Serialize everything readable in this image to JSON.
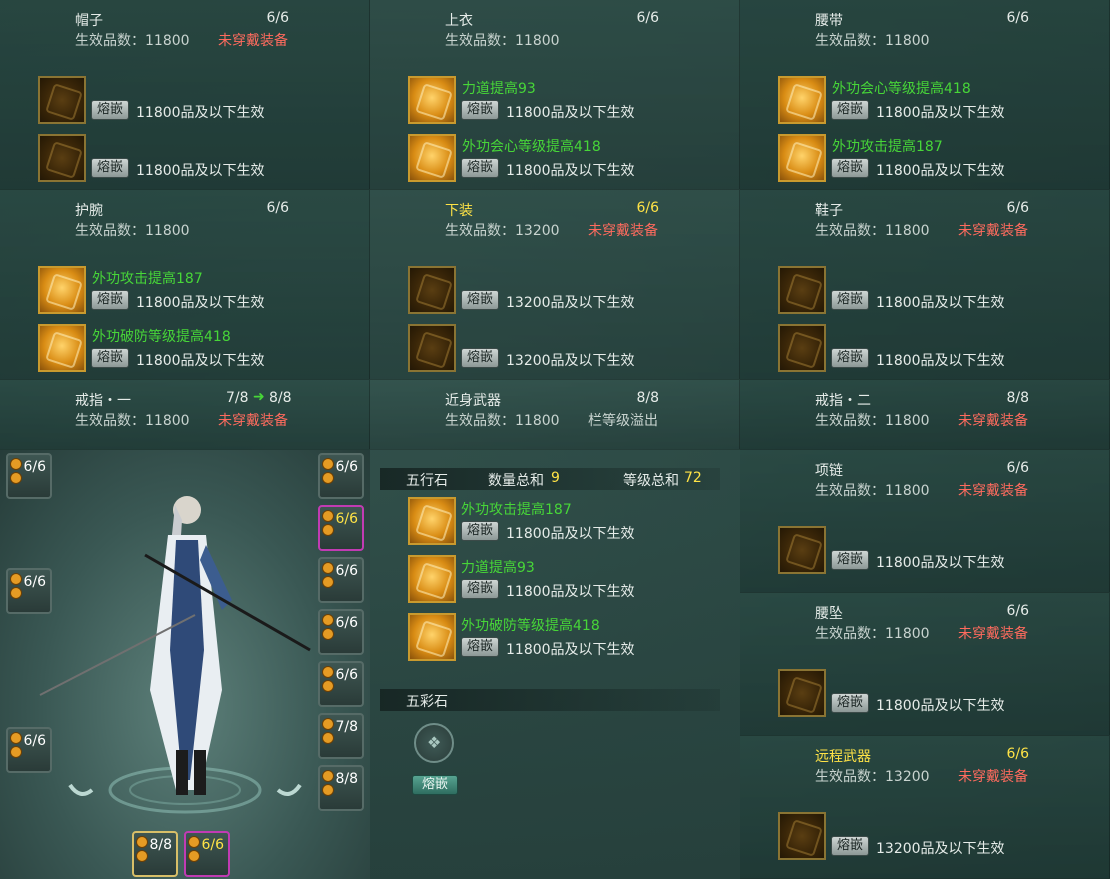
{
  "panels": [
    {
      "name": "帽子",
      "count": "6/6",
      "quality": "生效品数：11800",
      "warning": "未穿戴装备",
      "sockets": [
        {
          "filled": false,
          "effect": "",
          "button": "熔嵌",
          "text": "11800品及以下生效"
        },
        {
          "filled": false,
          "effect": "",
          "button": "熔嵌",
          "text": "11800品及以下生效"
        }
      ]
    },
    {
      "name": "上衣",
      "count": "6/6",
      "quality": "生效品数：11800",
      "warning": "",
      "sockets": [
        {
          "filled": true,
          "effect": "力道提高93",
          "button": "熔嵌",
          "text": "11800品及以下生效"
        },
        {
          "filled": true,
          "effect": "外功会心等级提高418",
          "button": "熔嵌",
          "text": "11800品及以下生效"
        }
      ]
    },
    {
      "name": "腰带",
      "count": "6/6",
      "quality": "生效品数：11800",
      "warning": "",
      "sockets": [
        {
          "filled": true,
          "effect": "外功会心等级提高418",
          "button": "熔嵌",
          "text": "11800品及以下生效"
        },
        {
          "filled": true,
          "effect": "外功攻击提高187",
          "button": "熔嵌",
          "text": "11800品及以下生效"
        }
      ]
    },
    {
      "name": "护腕",
      "count": "6/6",
      "quality": "生效品数：11800",
      "warning": "",
      "sockets": [
        {
          "filled": true,
          "effect": "外功攻击提高187",
          "button": "熔嵌",
          "text": "11800品及以下生效"
        },
        {
          "filled": true,
          "effect": "外功破防等级提高418",
          "button": "熔嵌",
          "text": "11800品及以下生效"
        }
      ]
    },
    {
      "name": "下装",
      "count": "6/6",
      "quality": "生效品数：13200",
      "warning": "未穿戴装备",
      "highlight": true,
      "sockets": [
        {
          "filled": false,
          "effect": "",
          "button": "熔嵌",
          "text": "13200品及以下生效"
        },
        {
          "filled": false,
          "effect": "",
          "button": "熔嵌",
          "text": "13200品及以下生效"
        }
      ]
    },
    {
      "name": "鞋子",
      "count": "6/6",
      "quality": "生效品数：11800",
      "warning": "未穿戴装备",
      "sockets": [
        {
          "filled": false,
          "effect": "",
          "button": "熔嵌",
          "text": "11800品及以下生效"
        },
        {
          "filled": false,
          "effect": "",
          "button": "熔嵌",
          "text": "11800品及以下生效"
        }
      ]
    }
  ],
  "row3": {
    "ring1": {
      "name": "戒指・一",
      "count": "7/8",
      "count_next": "8/8",
      "quality": "生效品数：11800",
      "warning": "未穿戴装备"
    },
    "melee": {
      "name": "近身武器",
      "count": "8/8",
      "quality": "生效品数：11800",
      "warning": "栏等级溢出"
    },
    "ring2": {
      "name": "戒指・二",
      "count": "8/8",
      "quality": "生效品数：11800",
      "warning": "未穿戴装备"
    }
  },
  "right_panels": [
    {
      "name": "项链",
      "count": "6/6",
      "quality": "生效品数：11800",
      "warning": "未穿戴装备",
      "button": "熔嵌",
      "text": "11800品及以下生效"
    },
    {
      "name": "腰坠",
      "count": "6/6",
      "quality": "生效品数：11800",
      "warning": "未穿戴装备",
      "button": "熔嵌",
      "text": "11800品及以下生效"
    },
    {
      "name": "远程武器",
      "count": "6/6",
      "quality": "生效品数：13200",
      "warning": "未穿戴装备",
      "button": "熔嵌",
      "text": "13200品及以下生效"
    }
  ],
  "wuxing": {
    "title": "五行石",
    "qty_label": "数量总和",
    "qty": "9",
    "lvl_label": "等级总和",
    "lvl": "72",
    "gems": [
      {
        "effect": "外功攻击提高187",
        "button": "熔嵌",
        "text": "11800品及以下生效"
      },
      {
        "effect": "力道提高93",
        "button": "熔嵌",
        "text": "11800品及以下生效"
      },
      {
        "effect": "外功破防等级提高418",
        "button": "熔嵌",
        "text": "11800品及以下生效"
      }
    ]
  },
  "wucai": {
    "title": "五彩石",
    "button": "熔嵌"
  },
  "slots": {
    "left": [
      "6/6",
      "6/6",
      "6/6"
    ],
    "right": [
      "6/6",
      "6/6",
      "6/6",
      "6/6",
      "6/6",
      "7/8",
      "8/8"
    ],
    "bottom": [
      "8/8",
      "6/6"
    ]
  },
  "colors": {
    "green": "#47d638",
    "warning": "#ff6b5e",
    "yellow": "#ffe346"
  }
}
